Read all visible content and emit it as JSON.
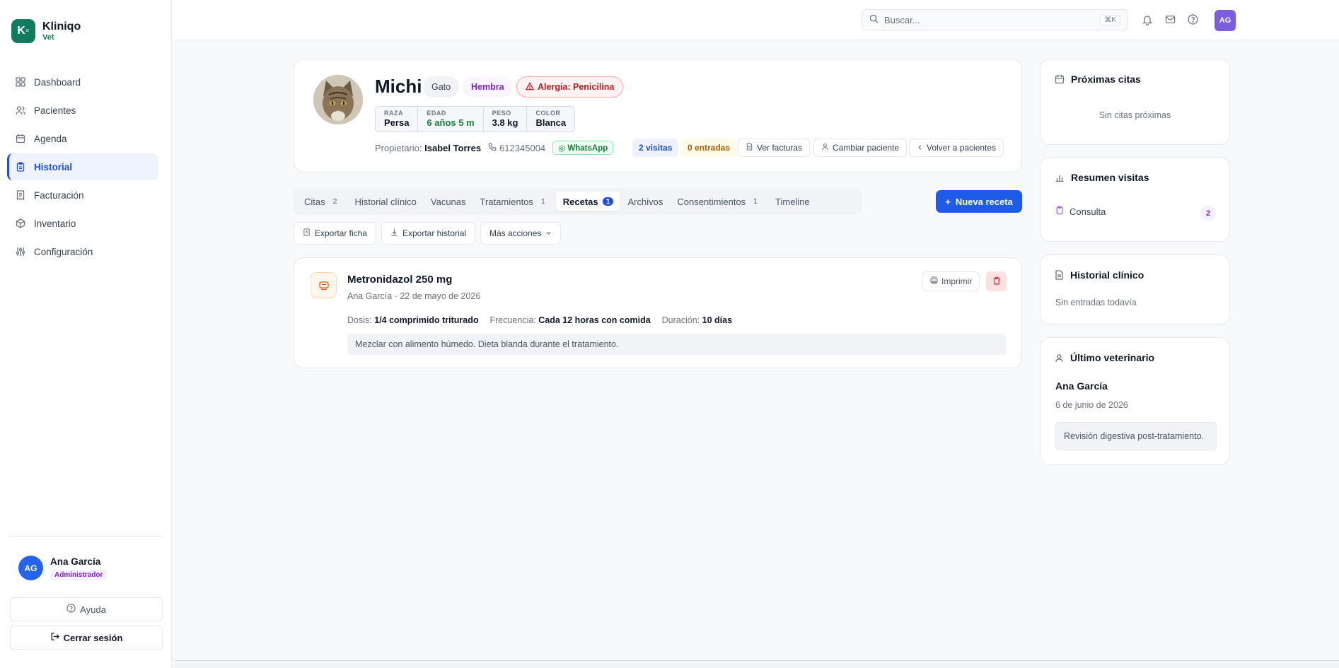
{
  "brand": {
    "logo": "K◦",
    "name": "Kliniqo",
    "sub": "Vet"
  },
  "nav": [
    {
      "label": "Dashboard",
      "icon": "grid-icon",
      "active": false
    },
    {
      "label": "Pacientes",
      "icon": "users-icon",
      "active": false
    },
    {
      "label": "Agenda",
      "icon": "calendar-icon",
      "active": false
    },
    {
      "label": "Historial",
      "icon": "clipboard-icon",
      "active": true
    },
    {
      "label": "Facturación",
      "icon": "receipt-icon",
      "active": false
    },
    {
      "label": "Inventario",
      "icon": "box-icon",
      "active": false
    },
    {
      "label": "Configuración",
      "icon": "sliders-icon",
      "active": false
    }
  ],
  "user": {
    "initials": "AG",
    "name": "Ana García",
    "role": "Administrador"
  },
  "sidebar_buttons": {
    "help": "Ayuda",
    "logout": "Cerrar sesión"
  },
  "topbar": {
    "search_placeholder": "Buscar...",
    "search_shortcut": "⌘K",
    "avatar": "AG"
  },
  "patient": {
    "name": "Michi",
    "species": "Gato",
    "sex": "Hembra",
    "allergy": "Alergia: Penicilina",
    "stats": [
      {
        "label": "RAZA",
        "value": "Persa",
        "highlight": false
      },
      {
        "label": "EDAD",
        "value": "6 años 5 m",
        "highlight": true
      },
      {
        "label": "PESO",
        "value": "3.8 kg",
        "highlight": false
      },
      {
        "label": "COLOR",
        "value": "Blanca",
        "highlight": false
      }
    ],
    "owner_label": "Propietario:",
    "owner_name": "Isabel Torres",
    "phone": "612345004",
    "whatsapp": "WhatsApp",
    "visits": "2 visitas",
    "entries": "0 entradas",
    "actions": {
      "invoices": "Ver facturas",
      "change": "Cambiar paciente",
      "back": "Volver a pacientes"
    }
  },
  "tabs": [
    {
      "label": "Citas",
      "count": "2"
    },
    {
      "label": "Historial clínico",
      "count": ""
    },
    {
      "label": "Vacunas",
      "count": ""
    },
    {
      "label": "Tratamientos",
      "count": "1"
    },
    {
      "label": "Recetas",
      "count": "1",
      "active": true
    },
    {
      "label": "Archivos",
      "count": ""
    },
    {
      "label": "Consentimientos",
      "count": "1"
    },
    {
      "label": "Timeline",
      "count": ""
    }
  ],
  "new_button": "Nueva receta",
  "actions": {
    "export_sheet": "Exportar ficha",
    "export_history": "Exportar historial",
    "more": "Más acciones"
  },
  "prescription": {
    "title": "Metronidazol 250 mg",
    "meta": "Ana García · 22 de mayo de 2026",
    "dose_label": "Dosis:",
    "dose": "1/4 comprimido triturado",
    "freq_label": "Frecuencia:",
    "freq": "Cada 12 horas con comida",
    "dur_label": "Duración:",
    "dur": "10 días",
    "note": "Mezclar con alimento húmedo. Dieta blanda durante el tratamiento.",
    "print": "Imprimir"
  },
  "side": {
    "upcoming": {
      "title": "Próximas citas",
      "empty": "Sin citas próximas"
    },
    "summary": {
      "title": "Resumen visitas",
      "item": "Consulta",
      "count": "2"
    },
    "history": {
      "title": "Historial clínico",
      "empty": "Sin entradas todavía"
    },
    "last_vet": {
      "title": "Último veterinario",
      "name": "Ana García",
      "date": "6 de junio de 2026",
      "note": "Revisión digestiva post-tratamiento."
    }
  },
  "colors": {
    "primary": "#1d5be8",
    "brand": "#127a5e",
    "allergy": "#b91c1c"
  }
}
